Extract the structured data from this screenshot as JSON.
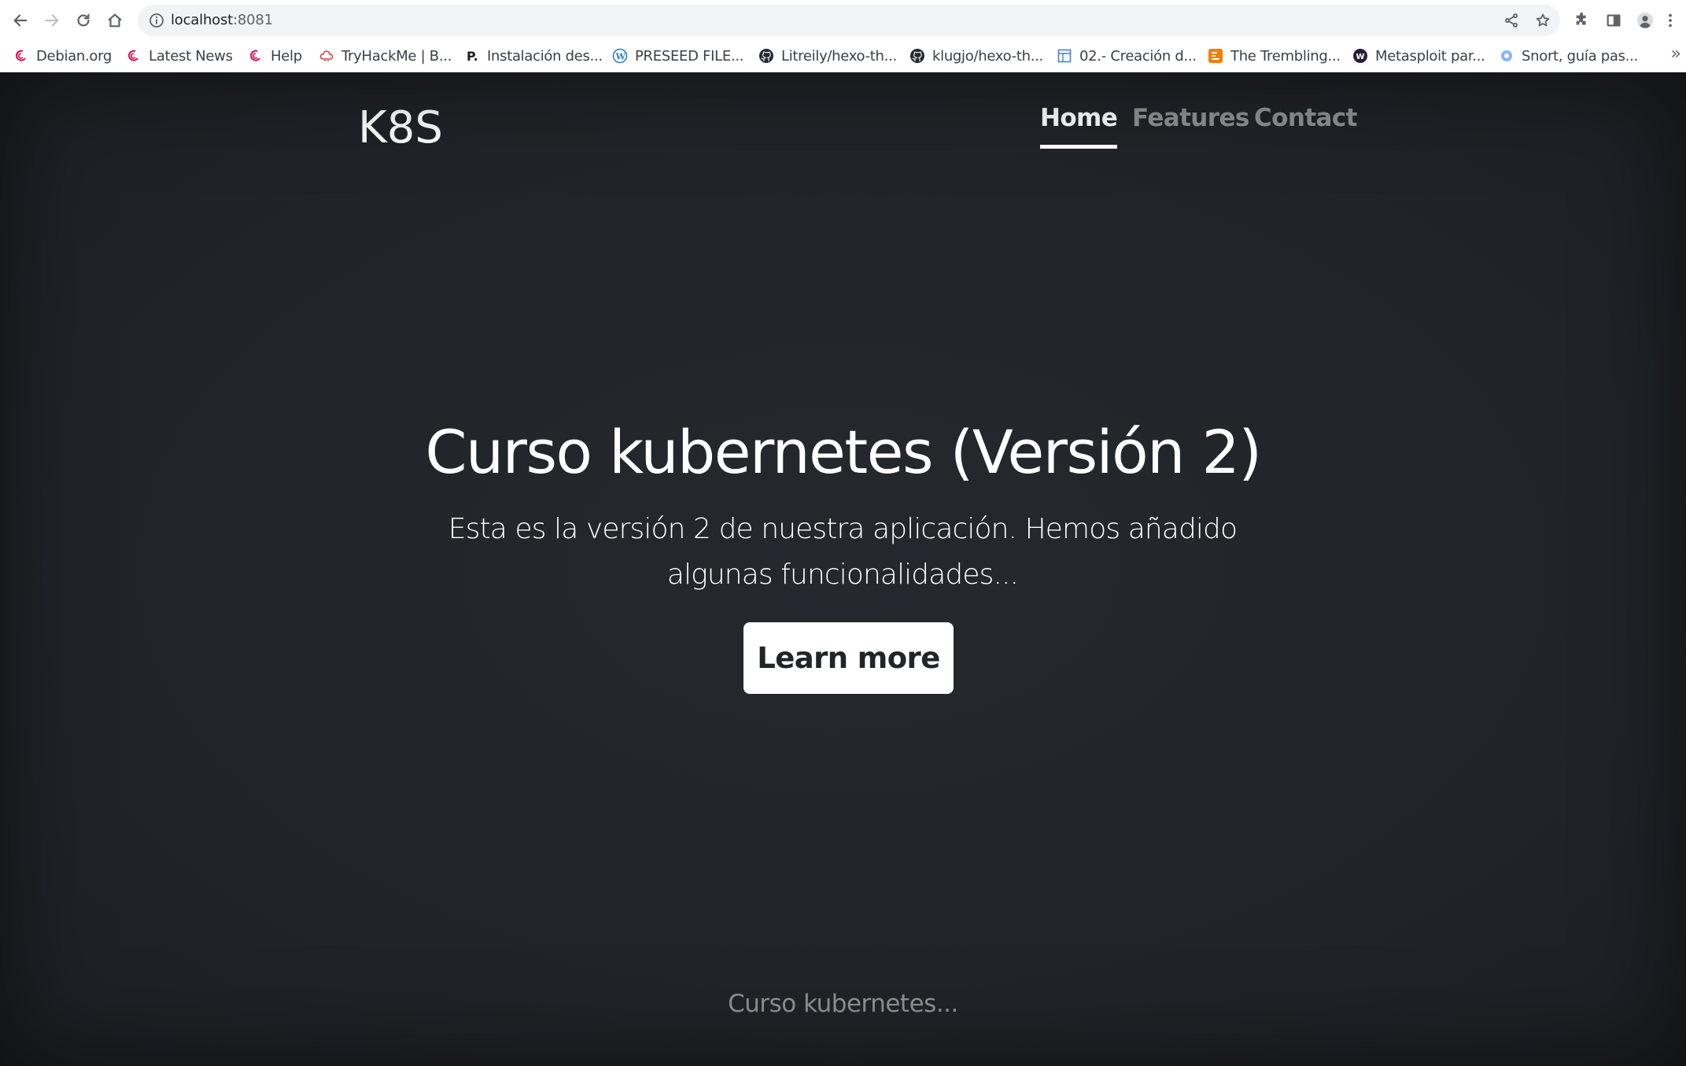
{
  "browser": {
    "url_host": "localhost",
    "url_port": ":8081",
    "toolbar_icons": [
      "back-icon",
      "forward-icon",
      "reload-icon",
      "home-icon",
      "info-icon",
      "share-icon",
      "star-icon",
      "extensions-icon",
      "side-panel-icon",
      "profile-icon",
      "menu-icon"
    ],
    "bookmarks": [
      {
        "label": "Debian.org",
        "icon": "debian-icon"
      },
      {
        "label": "Latest News",
        "icon": "debian-icon"
      },
      {
        "label": "Help",
        "icon": "debian-icon"
      },
      {
        "label": "TryHackMe | B...",
        "icon": "tryhackme-icon"
      },
      {
        "label": "Instalación des...",
        "icon": "p-icon"
      },
      {
        "label": "PRESEED FILE...",
        "icon": "wordpress-icon"
      },
      {
        "label": "Litreily/hexo-th...",
        "icon": "github-icon"
      },
      {
        "label": "klugjo/hexo-th...",
        "icon": "github-icon"
      },
      {
        "label": "02.- Creación d...",
        "icon": "page-icon"
      },
      {
        "label": "The Trembling...",
        "icon": "blogger-icon"
      },
      {
        "label": "Metasploit par...",
        "icon": "w-icon"
      },
      {
        "label": "Snort, guía pas...",
        "icon": "site-icon"
      }
    ],
    "bookmarks_overflow": "»"
  },
  "site": {
    "brand": "K8S",
    "nav": [
      {
        "label": "Home",
        "active": true
      },
      {
        "label": "Features",
        "active": false
      },
      {
        "label": "Contact",
        "active": false
      }
    ],
    "hero_title": "Curso kubernetes (Versión 2)",
    "hero_lead": "Esta es la versión 2 de nuestra aplicación. Hemos añadido algunas funcionalidades...",
    "hero_button": "Learn more",
    "footer": "Curso kubernetes..."
  },
  "colors": {
    "page_background": "#212529",
    "button_background": "#ffffff",
    "button_text": "#212529",
    "nav_muted": "rgba(255,255,255,0.5)"
  }
}
